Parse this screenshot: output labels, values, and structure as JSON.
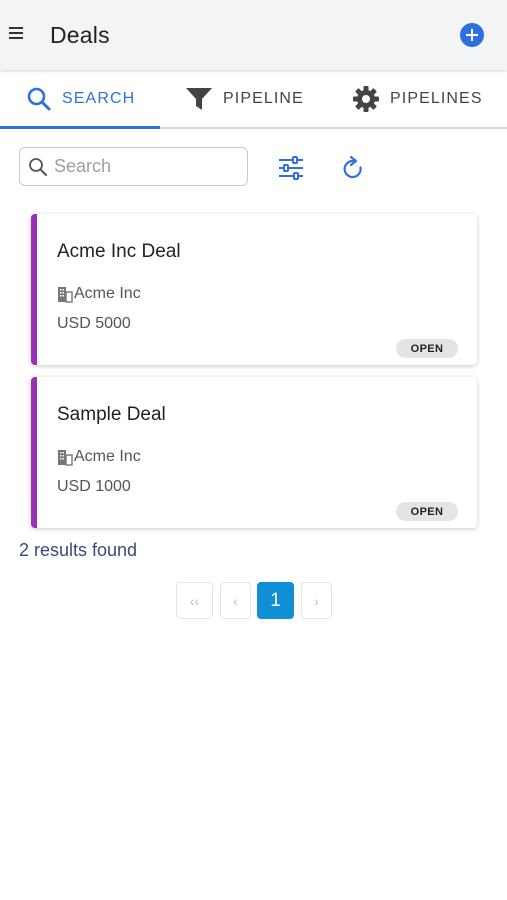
{
  "header": {
    "title": "Deals",
    "menu_icon": "hamburger-menu-icon",
    "add_icon": "plus-circle-icon"
  },
  "tabs": [
    {
      "label": "SEARCH",
      "icon": "search-icon",
      "active": true
    },
    {
      "label": "PIPELINE",
      "icon": "funnel-icon",
      "active": false
    },
    {
      "label": "PIPELINES",
      "icon": "gear-icon",
      "active": false
    }
  ],
  "search": {
    "placeholder": "Search",
    "value": ""
  },
  "toolbar": {
    "filter_icon": "sliders-icon",
    "refresh_icon": "refresh-icon"
  },
  "deals": [
    {
      "title": "Acme Inc Deal",
      "company": "Acme Inc",
      "amount": "USD 5000",
      "status": "OPEN"
    },
    {
      "title": "Sample Deal",
      "company": "Acme Inc",
      "amount": "USD 1000",
      "status": "OPEN"
    }
  ],
  "results_text": "2 results found",
  "pagination": {
    "first": "‹‹",
    "prev": "‹",
    "current": "1",
    "next": "›"
  },
  "colors": {
    "accent": "#2f6fde",
    "card_border": "#9c2fb8",
    "page_active": "#0f8fd6",
    "results_text": "#3a4a78"
  }
}
